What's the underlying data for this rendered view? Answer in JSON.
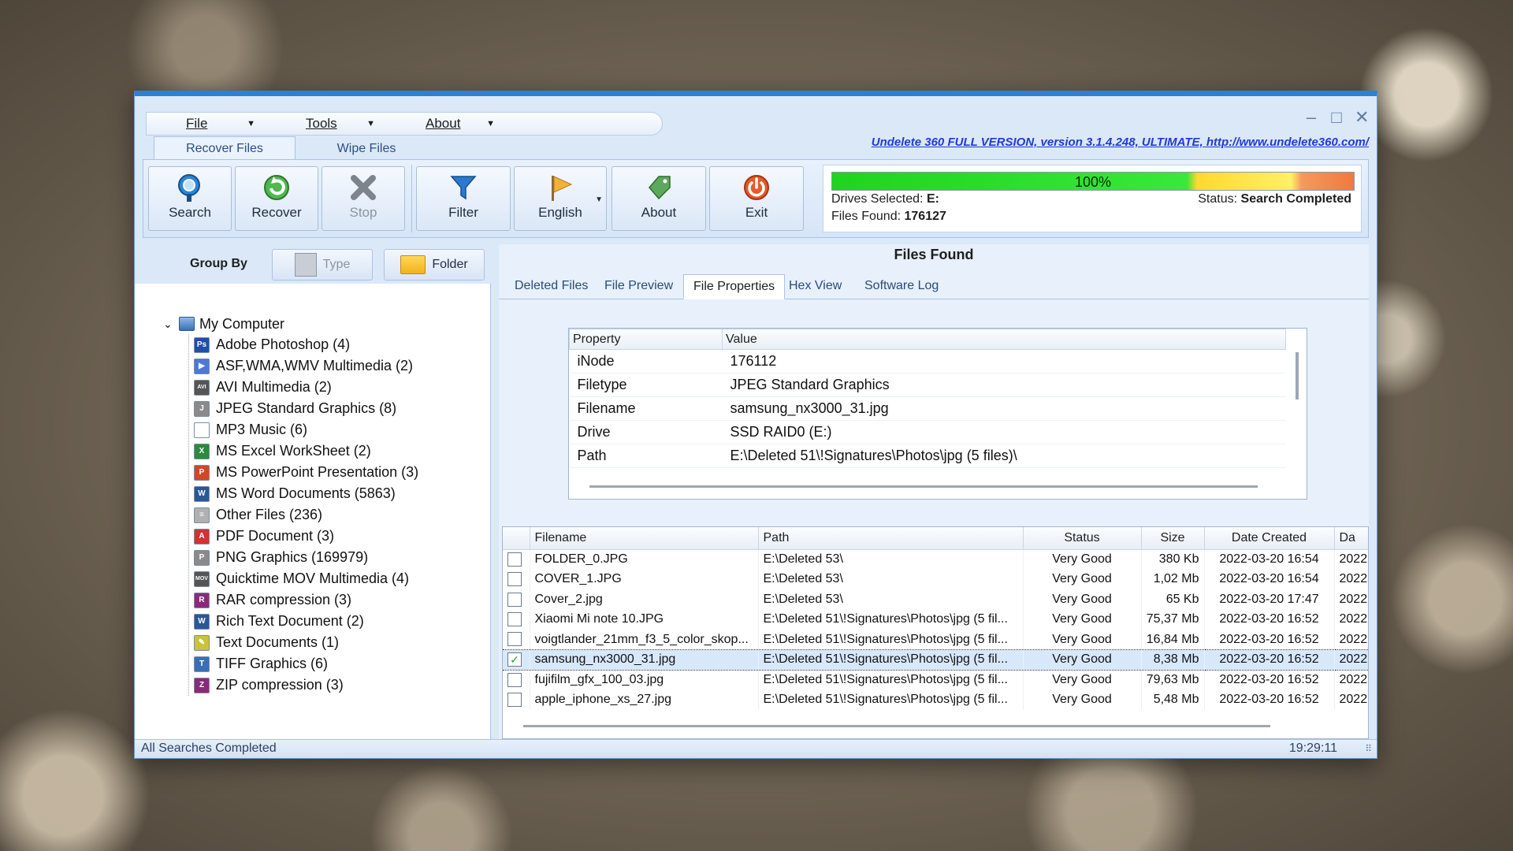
{
  "window": {
    "menu": [
      {
        "label": "File"
      },
      {
        "label": "Tools"
      },
      {
        "label": "About"
      }
    ],
    "top_tabs": [
      "Recover Files",
      "Wipe Files"
    ],
    "version_link": "Undelete 360 FULL VERSION, version 3.1.4.248, ULTIMATE, http://www.undelete360.com/"
  },
  "toolbar": {
    "search": "Search",
    "recover": "Recover",
    "stop": "Stop",
    "filter": "Filter",
    "english": "English",
    "about": "About",
    "exit": "Exit"
  },
  "progress": {
    "percent_text": "100%",
    "percent": 100,
    "drives_label": "Drives Selected:",
    "drives_value": "E:",
    "files_label": "Files Found:",
    "files_value": "176127",
    "status_label": "Status:",
    "status_value": "Search Completed"
  },
  "groupby": {
    "label": "Group By",
    "type": "Type",
    "folder": "Folder"
  },
  "tree": {
    "root": "My Computer",
    "items": [
      {
        "label": "Adobe Photoshop (4)",
        "icon": "photoshop-icon",
        "color": "#1f4fa8",
        "glyph": "Ps"
      },
      {
        "label": "ASF,WMA,WMV Multimedia (2)",
        "icon": "media-icon",
        "color": "#4a7ad6",
        "glyph": "▶"
      },
      {
        "label": "AVI Multimedia (2)",
        "icon": "avi-icon",
        "color": "#555555",
        "glyph": "AVI"
      },
      {
        "label": "JPEG Standard Graphics (8)",
        "icon": "jpeg-icon",
        "color": "#8a8a8a",
        "glyph": "J"
      },
      {
        "label": "MP3 Music (6)",
        "icon": "blank-file-icon",
        "color": "#ffffff",
        "glyph": ""
      },
      {
        "label": "MS Excel WorkSheet (2)",
        "icon": "excel-icon",
        "color": "#2c8a3c",
        "glyph": "X"
      },
      {
        "label": "MS PowerPoint Presentation (3)",
        "icon": "powerpoint-icon",
        "color": "#d24726",
        "glyph": "P"
      },
      {
        "label": "MS Word Documents (5863)",
        "icon": "word-icon",
        "color": "#2b5797",
        "glyph": "W"
      },
      {
        "label": "Other Files (236)",
        "icon": "other-file-icon",
        "color": "#b0b0b0",
        "glyph": "≡"
      },
      {
        "label": "PDF Document (3)",
        "icon": "pdf-icon",
        "color": "#d23232",
        "glyph": "A"
      },
      {
        "label": "PNG Graphics (169979)",
        "icon": "png-icon",
        "color": "#8a8a8a",
        "glyph": "P"
      },
      {
        "label": "Quicktime MOV Multimedia (4)",
        "icon": "mov-icon",
        "color": "#555555",
        "glyph": "MOV"
      },
      {
        "label": "RAR compression (3)",
        "icon": "rar-icon",
        "color": "#8b2a7a",
        "glyph": "R"
      },
      {
        "label": "Rich Text Document (2)",
        "icon": "rtf-icon",
        "color": "#2b5797",
        "glyph": "W"
      },
      {
        "label": "Text Documents (1)",
        "icon": "text-file-icon",
        "color": "#c9c23a",
        "glyph": "✎"
      },
      {
        "label": "TIFF Graphics (6)",
        "icon": "tiff-icon",
        "color": "#3a6fb8",
        "glyph": "T"
      },
      {
        "label": "ZIP compression (3)",
        "icon": "zip-icon",
        "color": "#8b2a7a",
        "glyph": "Z"
      }
    ]
  },
  "main": {
    "title": "Files Found",
    "tabs": [
      "Deleted Files",
      "File Preview",
      "File Properties",
      "Hex View",
      "Software Log"
    ],
    "active_tab": "File Properties"
  },
  "properties": {
    "headers": [
      "Property",
      "Value"
    ],
    "rows": [
      {
        "property": "iNode",
        "value": "176112"
      },
      {
        "property": "Filetype",
        "value": "JPEG Standard Graphics"
      },
      {
        "property": "Filename",
        "value": "samsung_nx3000_31.jpg"
      },
      {
        "property": "Drive",
        "value": "SSD RAID0 (E:)"
      },
      {
        "property": "Path",
        "value": "E:\\Deleted 51\\!Signatures\\Photos\\jpg (5 files)\\"
      }
    ]
  },
  "files": {
    "headers": [
      "Filename",
      "Path",
      "Status",
      "Size",
      "Date Created",
      "Da"
    ],
    "rows": [
      {
        "checked": false,
        "filename": "FOLDER_0.JPG",
        "path": "E:\\Deleted 53\\",
        "status": "Very Good",
        "size": "380 Kb",
        "created": "2022-03-20 16:54",
        "da": "2022"
      },
      {
        "checked": false,
        "filename": "COVER_1.JPG",
        "path": "E:\\Deleted 53\\",
        "status": "Very Good",
        "size": "1,02 Mb",
        "created": "2022-03-20 16:54",
        "da": "2022"
      },
      {
        "checked": false,
        "filename": "Cover_2.jpg",
        "path": "E:\\Deleted 53\\",
        "status": "Very Good",
        "size": "65 Kb",
        "created": "2022-03-20 17:47",
        "da": "2022"
      },
      {
        "checked": false,
        "filename": "Xiaomi Mi note 10.JPG",
        "path": "E:\\Deleted 51\\!Signatures\\Photos\\jpg (5 fil...",
        "status": "Very Good",
        "size": "75,37 Mb",
        "created": "2022-03-20 16:52",
        "da": "2022"
      },
      {
        "checked": false,
        "filename": "voigtlander_21mm_f3_5_color_skop...",
        "path": "E:\\Deleted 51\\!Signatures\\Photos\\jpg (5 fil...",
        "status": "Very Good",
        "size": "16,84 Mb",
        "created": "2022-03-20 16:52",
        "da": "2022"
      },
      {
        "checked": true,
        "filename": "samsung_nx3000_31.jpg",
        "path": "E:\\Deleted 51\\!Signatures\\Photos\\jpg (5 fil...",
        "status": "Very Good",
        "size": "8,38 Mb",
        "created": "2022-03-20 16:52",
        "da": "2022"
      },
      {
        "checked": false,
        "filename": "fujifilm_gfx_100_03.jpg",
        "path": "E:\\Deleted 51\\!Signatures\\Photos\\jpg (5 fil...",
        "status": "Very Good",
        "size": "79,63 Mb",
        "created": "2022-03-20 16:52",
        "da": "2022"
      },
      {
        "checked": false,
        "filename": "apple_iphone_xs_27.jpg",
        "path": "E:\\Deleted 51\\!Signatures\\Photos\\jpg (5 fil...",
        "status": "Very Good",
        "size": "5,48 Mb",
        "created": "2022-03-20 16:52",
        "da": "2022"
      }
    ]
  },
  "statusbar": {
    "left": "All Searches Completed",
    "time": "19:29:11"
  },
  "colors": {
    "accent": "#2d7fd8",
    "good": "#2aa12a",
    "link": "#1f3bd8"
  }
}
